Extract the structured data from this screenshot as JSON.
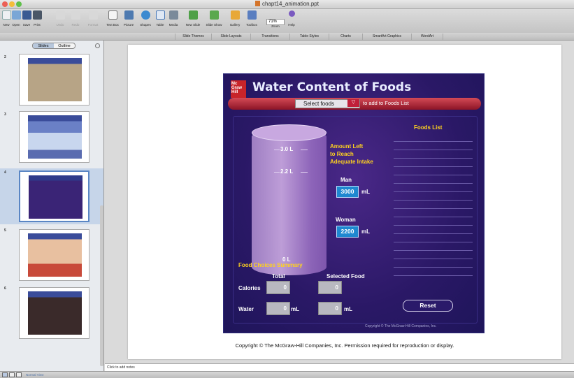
{
  "window": {
    "title": "chapt14_animation.ppt"
  },
  "toolbar": {
    "buttons": [
      {
        "label": "New",
        "icon": "new-icon",
        "enabled": true
      },
      {
        "label": "Open",
        "icon": "open-icon",
        "enabled": true
      },
      {
        "label": "Save",
        "icon": "save-icon",
        "enabled": true
      },
      {
        "label": "Print",
        "icon": "print-icon",
        "enabled": true
      },
      {
        "label": "Undo",
        "icon": "undo-icon",
        "enabled": false
      },
      {
        "label": "Redo",
        "icon": "redo-icon",
        "enabled": false
      },
      {
        "label": "Format",
        "icon": "format-icon",
        "enabled": false
      },
      {
        "label": "Text Box",
        "icon": "text-box-icon",
        "enabled": true
      },
      {
        "label": "Picture",
        "icon": "picture-icon",
        "enabled": true
      },
      {
        "label": "Shapes",
        "icon": "shapes-icon",
        "enabled": true
      },
      {
        "label": "Table",
        "icon": "table-icon",
        "enabled": true
      },
      {
        "label": "Media",
        "icon": "media-icon",
        "enabled": true
      },
      {
        "label": "New Slide",
        "icon": "new-slide-icon",
        "enabled": true
      },
      {
        "label": "Slide Show",
        "icon": "slide-show-icon",
        "enabled": true
      },
      {
        "label": "Gallery",
        "icon": "gallery-icon",
        "enabled": true
      },
      {
        "label": "Toolbox",
        "icon": "toolbox-icon",
        "enabled": true
      },
      {
        "label": "Zoom",
        "icon": "zoom-icon",
        "enabled": true
      },
      {
        "label": "Help",
        "icon": "help-icon",
        "enabled": true
      }
    ],
    "zoom_value": "71%"
  },
  "ribbon": {
    "tabs": [
      "Slide Themes",
      "Slide Layouts",
      "Transitions",
      "Table Styles",
      "Charts",
      "SmartArt Graphics",
      "WordArt"
    ]
  },
  "left_pane": {
    "tabs": [
      "Slides",
      "Outline"
    ],
    "active_tab": "Slides",
    "slides": [
      {
        "number": "2",
        "selected": false
      },
      {
        "number": "3",
        "selected": false
      },
      {
        "number": "4",
        "selected": true
      },
      {
        "number": "5",
        "selected": false
      },
      {
        "number": "6",
        "selected": false
      }
    ]
  },
  "animation": {
    "logo_lines": [
      "Mc",
      "Graw",
      "Hill"
    ],
    "title": "Water Content of Foods",
    "select_label": "Select foods",
    "select_hint": "to add to Foods List",
    "cylinder_labels": [
      "3.0 L",
      "2.2 L",
      "0 L"
    ],
    "amount_label_lines": [
      "Amount Left",
      "to Reach",
      "Adequate Intake"
    ],
    "man_label": "Man",
    "man_value": "3000",
    "woman_label": "Woman",
    "woman_value": "2200",
    "unit_ml": "mL",
    "foods_list_title": "Foods List",
    "summary_title": "Food Choices Summary",
    "total_header": "Total",
    "selected_header": "Selected Food",
    "calories_label": "Calories",
    "calories_total": "0",
    "calories_selected": "0",
    "water_label": "Water",
    "water_total": "0",
    "water_selected": "0",
    "reset_label": "Reset",
    "copyright": "Copyright © The McGraw-Hill Companies, Inc."
  },
  "slide": {
    "copyright_line": "Copyright © The McGraw-Hill Companies, Inc. Permission required for reproduction or display."
  },
  "notes": {
    "placeholder": "Click to add notes"
  },
  "status": {
    "view_label": "Normal View"
  },
  "colors": {
    "accent": "#5a86c4",
    "brand_red": "#c8242a",
    "anim_purple": "#2a1866",
    "highlight_yellow": "#ffd21f"
  }
}
